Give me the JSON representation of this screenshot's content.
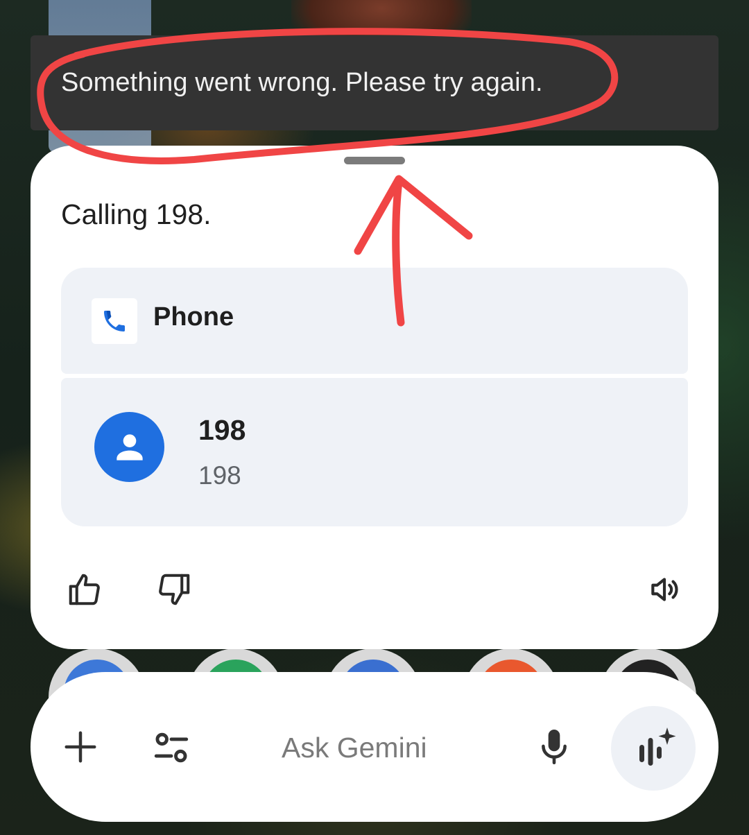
{
  "snackbar": {
    "message": "Something went wrong. Please try again."
  },
  "card": {
    "response_text": "Calling 198.",
    "app": {
      "label": "Phone",
      "icon": "phone-icon"
    },
    "contact": {
      "name": "198",
      "number": "198",
      "icon": "person-icon"
    },
    "actions": {
      "thumbs_up_icon": "thumbs-up-icon",
      "thumbs_down_icon": "thumbs-down-icon",
      "read_aloud_icon": "speaker-icon"
    }
  },
  "input_bar": {
    "placeholder": "Ask Gemini",
    "add_icon": "plus-icon",
    "tools_icon": "tune-icon",
    "mic_icon": "mic-icon",
    "live_icon": "gemini-live-icon"
  },
  "colors": {
    "annotation_red": "#f04545",
    "avatar_blue": "#1f6fe0",
    "snackbar_bg": "#333333",
    "card_tile_bg": "#eff2f7"
  }
}
